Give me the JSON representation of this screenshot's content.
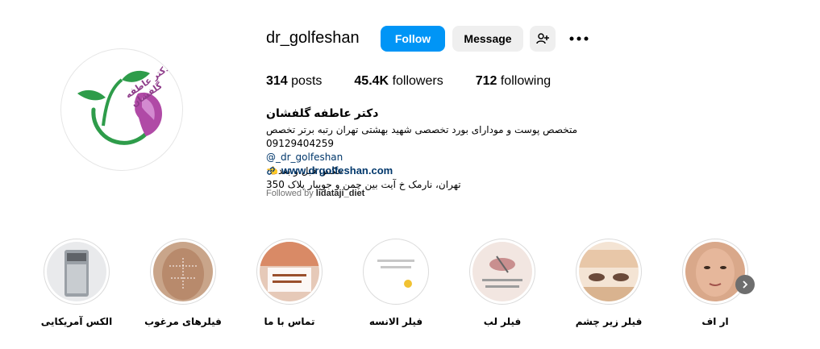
{
  "profile": {
    "username": "dr_golfeshan",
    "follow_label": "Follow",
    "message_label": "Message",
    "logo_text": "دکتر عاطفه گلفشان"
  },
  "stats": {
    "posts_count": "314",
    "posts_label": "posts",
    "followers_count": "45.4K",
    "followers_label": "followers",
    "following_count": "712",
    "following_label": "following"
  },
  "bio": {
    "name": "دکتر عاطفه گلفشان",
    "line1": "متخصص پوست و مو‌دارای بورد تخصصی شهید بهشتی تهران رتبه برتر تخصص 09129404259",
    "line2": "dr_golfeshan_@",
    "line3": "عکس قبل و بعد👈",
    "line4": "تهران، نارمک خ آیت بین چمن و جویبار پلاک 350",
    "website": "www.drgolfeshan.com",
    "followed_prefix": "Followed by ",
    "followed_user": "lidataji_diet"
  },
  "highlights": [
    {
      "label": "الکس آمریکایی"
    },
    {
      "label": "فیلرهای مرغوب"
    },
    {
      "label": "تماس با ما"
    },
    {
      "label": "فیلر الانسه"
    },
    {
      "label": "فیلر لب"
    },
    {
      "label": "فیلر زیر چشم"
    },
    {
      "label": "ار اف"
    }
  ],
  "colors": {
    "follow_blue": "#0095f6",
    "logo_green": "#2e9c4a",
    "logo_purple": "#8e3c8a"
  }
}
